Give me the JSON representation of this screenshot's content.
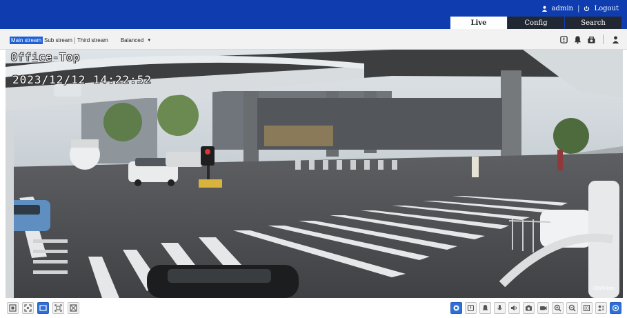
{
  "header": {
    "user_label": "admin",
    "logout_label": "Logout",
    "separator": "|"
  },
  "tabs": [
    {
      "label": "Live",
      "active": true
    },
    {
      "label": "Config",
      "active": false
    },
    {
      "label": "Search",
      "active": false
    }
  ],
  "stream_bar": {
    "streams": [
      {
        "label": "Main stream",
        "active": true
      },
      {
        "label": "Sub stream",
        "active": false
      },
      {
        "label": "Third stream",
        "active": false
      }
    ],
    "quality_value": "Balanced",
    "quality_caret": "▼"
  },
  "video": {
    "osd_name": "Office-Top",
    "osd_time": "2023/12/12 14:22:52",
    "bitrate": "2866Kbps"
  },
  "toolbar_icons": {
    "top_right": [
      "alarm-out-icon",
      "alarm-icon",
      "record-alarm-icon",
      "person-icon"
    ],
    "bottom_left": [
      "original-size-icon",
      "fit-icon",
      "fullscreen-icon",
      "zoom-area-icon",
      "crop-icon"
    ],
    "bottom_right": [
      "stop-icon",
      "alarm-out-icon",
      "alarm-icon",
      "microphone-icon",
      "speaker-icon",
      "snapshot-icon",
      "record-icon",
      "zoom-in-icon",
      "zoom-out-icon",
      "3d-position-icon",
      "face-icon",
      "ptz-icon"
    ]
  },
  "colors": {
    "header_blue": "#0f3db0",
    "tab_dark": "#222833",
    "accent_blue": "#2f6fd6"
  }
}
